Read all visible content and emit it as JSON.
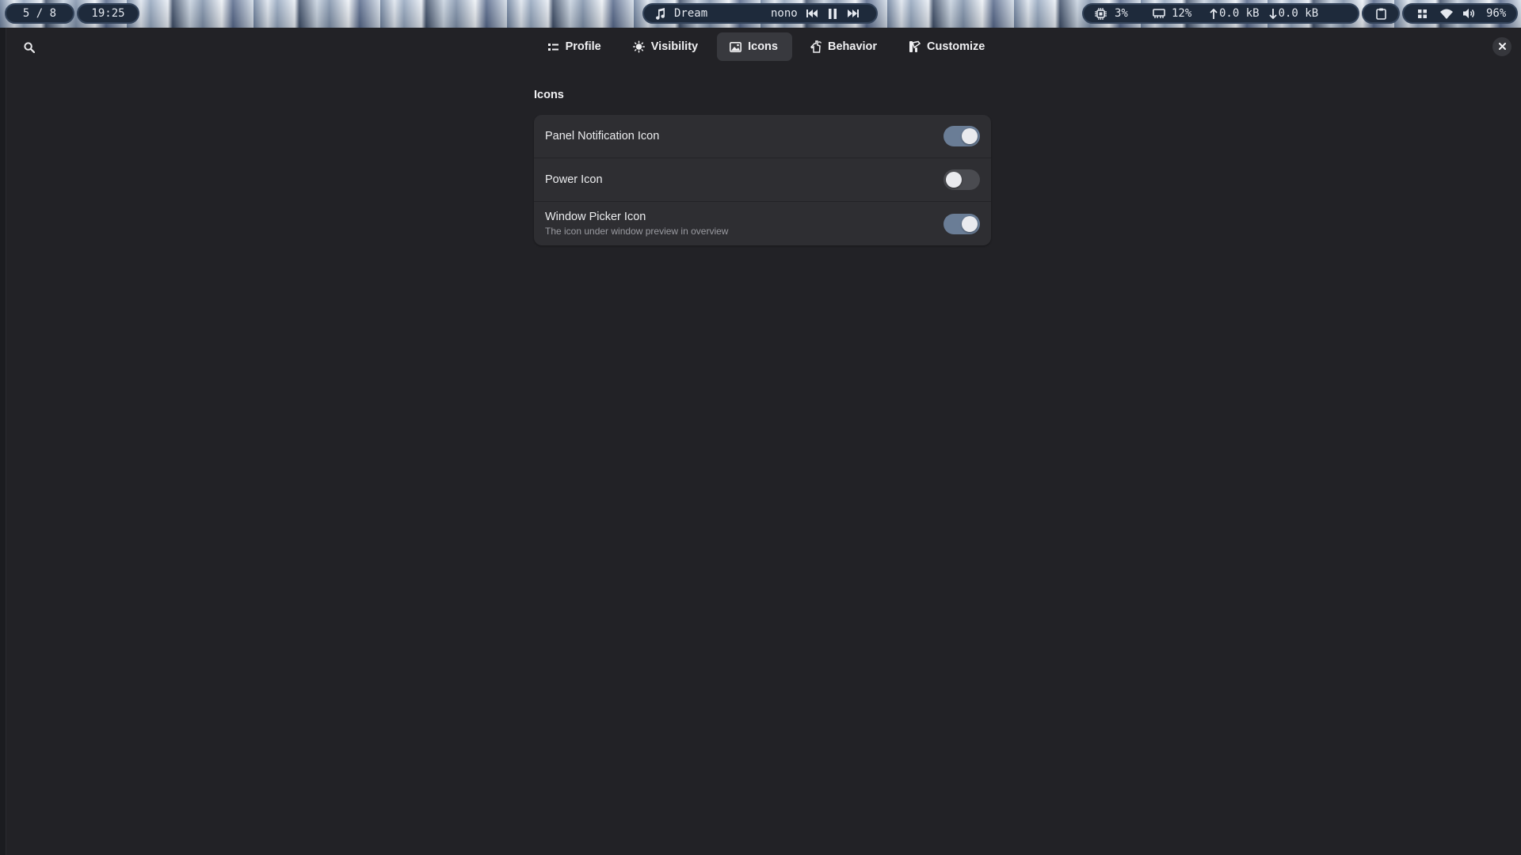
{
  "topbar": {
    "workspace": "5 / 8",
    "clock": "19:25",
    "media": {
      "title": "Dream",
      "artist": "nono"
    },
    "stats": {
      "cpu": "3%",
      "ram": "12%",
      "upload": "0.0 kB",
      "download": "0.0 kB"
    },
    "volume": "96%",
    "icons": {
      "music": "music-note-icon",
      "prev": "skip-previous-icon",
      "pause": "pause-icon",
      "next": "skip-next-icon",
      "cpu": "cpu-chip-icon",
      "ram": "memory-icon",
      "up": "arrow-up-icon",
      "down": "arrow-down-icon",
      "clipboard": "clipboard-icon",
      "apps": "grid-icon",
      "wifi": "wifi-icon",
      "volume": "speaker-icon"
    }
  },
  "tabs": [
    {
      "label": "Profile",
      "icon": "profile-list-icon",
      "active": false
    },
    {
      "label": "Visibility",
      "icon": "sun-icon",
      "active": false
    },
    {
      "label": "Icons",
      "icon": "image-icon",
      "active": true
    },
    {
      "label": "Behavior",
      "icon": "hand-pointer-icon",
      "active": false
    },
    {
      "label": "Customize",
      "icon": "brush-icon",
      "active": false
    }
  ],
  "section": {
    "title": "Icons",
    "rows": [
      {
        "label": "Panel Notification Icon",
        "subtitle": "",
        "enabled": true
      },
      {
        "label": "Power Icon",
        "subtitle": "",
        "enabled": false
      },
      {
        "label": "Window Picker Icon",
        "subtitle": "The icon under window preview in overview",
        "enabled": true
      }
    ]
  },
  "colors": {
    "window_bg": "#222226",
    "row_bg": "#2e2e32",
    "switch_on": "#6a7d96",
    "switch_off": "#4a4b50",
    "tab_active": "#38393e"
  }
}
